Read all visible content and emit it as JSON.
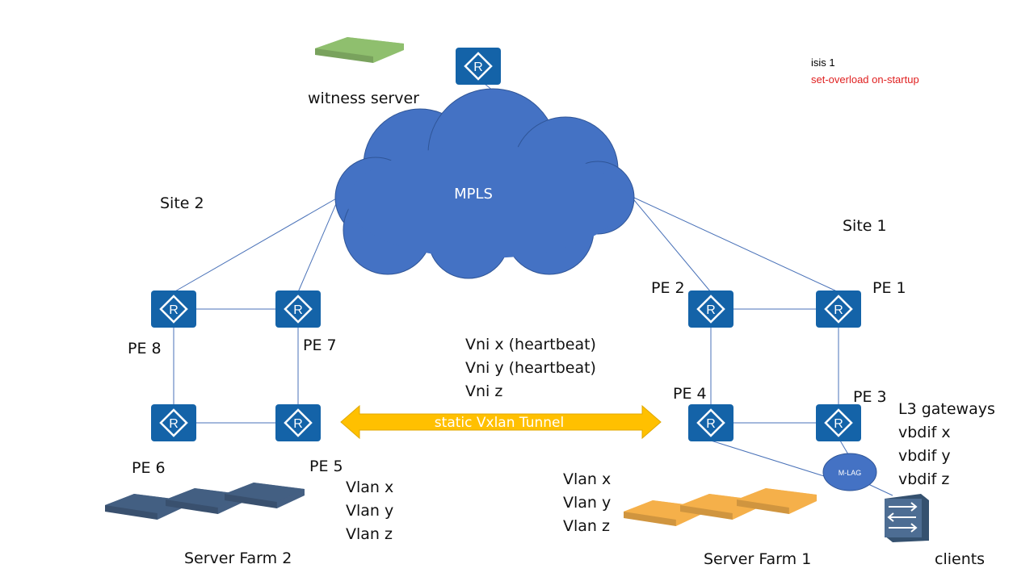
{
  "colors": {
    "router": "#1463a8",
    "cloud": "#4472c4",
    "link": "#4a72b8",
    "tunnel": "#ffc000",
    "witness": "#8fbf6e",
    "farm1": "#f5b04a",
    "farm2": "#445f82",
    "switch": "#4d6d93",
    "red_text": "#e02020"
  },
  "icons": {
    "router": "router-icon",
    "server": "server-icon",
    "switch": "switch-icon",
    "cloud": "cloud-icon"
  },
  "witness": {
    "label": "witness server"
  },
  "config": {
    "line1": "isis 1",
    "line2": "set-overload on-startup"
  },
  "cloud": {
    "label": "MPLS"
  },
  "sites": {
    "site1": "Site 1",
    "site2": "Site 2"
  },
  "routers": {
    "pe1": "PE 1",
    "pe2": "PE 2",
    "pe3": "PE 3",
    "pe4": "PE 4",
    "pe5": "PE 5",
    "pe6": "PE 6",
    "pe7": "PE 7",
    "pe8": "PE 8",
    "glyph": "R"
  },
  "vni": [
    "Vni x (heartbeat)",
    "Vni y (heartbeat)",
    "Vni z"
  ],
  "tunnel": {
    "label": "static Vxlan Tunnel"
  },
  "gateways": [
    "L3 gateways",
    "vbdif x",
    "vbdif y",
    "vbdif z"
  ],
  "vlans_site2": [
    "Vlan x",
    "Vlan y",
    "Vlan z"
  ],
  "vlans_site1": [
    "Vlan x",
    "Vlan y",
    "Vlan z"
  ],
  "mlag": {
    "label": "M-LAG"
  },
  "farms": {
    "farm1": "Server Farm 1",
    "farm2": "Server Farm 2"
  },
  "clients": {
    "label": "clients"
  }
}
